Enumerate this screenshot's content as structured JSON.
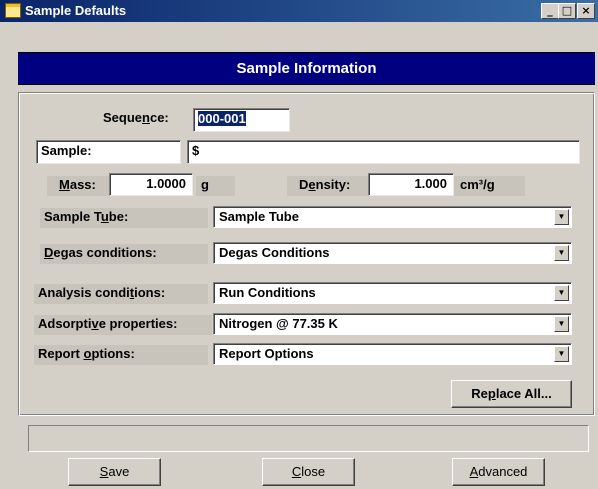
{
  "window": {
    "title": "Sample Defaults",
    "minimize_glyph": "_",
    "maximize_glyph": "□",
    "close_glyph": "×"
  },
  "header": {
    "title": "Sample Information"
  },
  "form": {
    "sequence": {
      "label_pre": "Seque",
      "label_ul": "n",
      "label_post": "ce:",
      "value": "000-001"
    },
    "sample": {
      "label": "Sample:",
      "value": "$"
    },
    "mass": {
      "label_ul": "M",
      "label_post": "ass:",
      "value": "1.0000",
      "unit": "g"
    },
    "density": {
      "label_pre": "D",
      "label_ul": "e",
      "label_post": "nsity:",
      "value": "1.000",
      "unit": "cm³/g"
    },
    "sample_tube": {
      "label_pre": "Sample T",
      "label_ul": "u",
      "label_post": "be:",
      "value": "Sample Tube"
    },
    "degas": {
      "label_ul": "D",
      "label_post": "egas conditions:",
      "value": "Degas Conditions"
    },
    "analysis": {
      "label_pre": "Analysis condi",
      "label_ul": "t",
      "label_post": "ions:",
      "value": "Run Conditions"
    },
    "adsorptive": {
      "label_pre": "Adsorpti",
      "label_ul": "v",
      "label_post": "e properties:",
      "value": "Nitrogen @ 77.35 K"
    },
    "report": {
      "label_pre": "Report ",
      "label_ul": "o",
      "label_post": "ptions:",
      "value": "Report Options"
    },
    "dropdown_glyph": "▼",
    "replace_all": {
      "pre": "Re",
      "ul": "p",
      "post": "lace All..."
    }
  },
  "status": {
    "text": ""
  },
  "buttons": {
    "save": {
      "ul": "S",
      "post": "ave"
    },
    "close": {
      "ul": "C",
      "post": "lose"
    },
    "advanced": {
      "ul": "A",
      "post": "dvanced"
    }
  }
}
